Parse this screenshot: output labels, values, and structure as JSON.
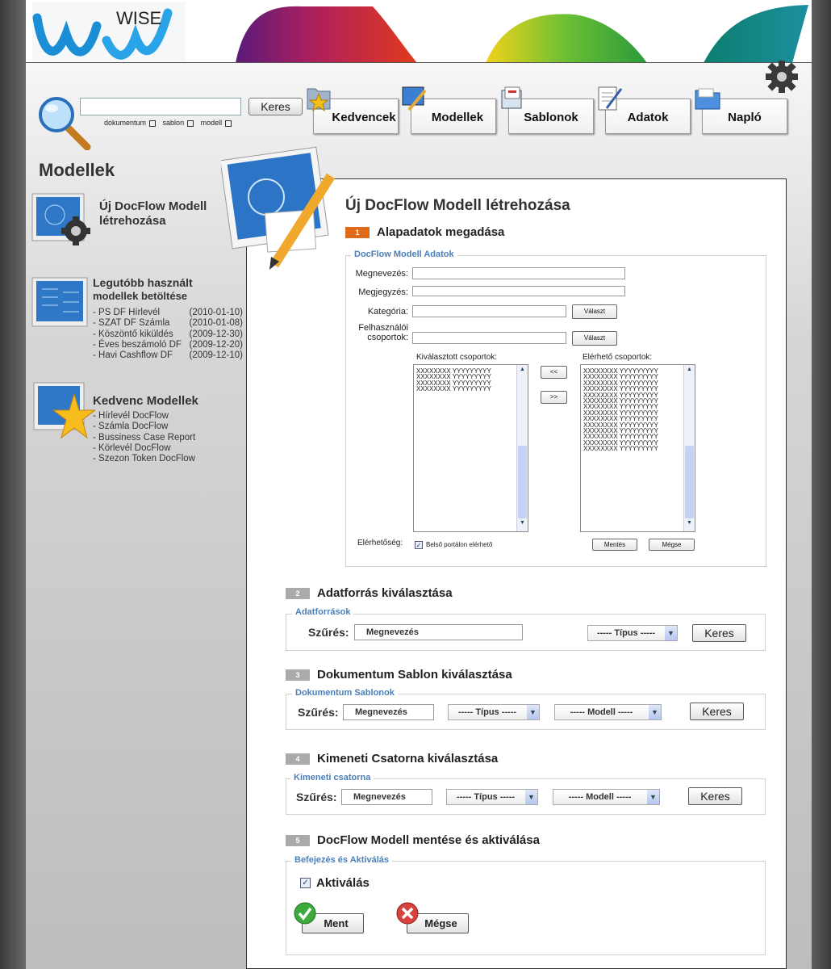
{
  "brand": {
    "logo_text": "WISE"
  },
  "search": {
    "button": "Keres",
    "scope": [
      "dokumentum",
      "sablon",
      "modell"
    ]
  },
  "nav": {
    "tabs": [
      "Kedvencek",
      "Modellek",
      "Sablonok",
      "Adatok",
      "Napló"
    ]
  },
  "sidebar": {
    "title": "Modellek",
    "new_model": "Új DocFlow Modell létrehozása",
    "recent_title_1": "Legutóbb használt",
    "recent_title_2": "modellek betöltése",
    "recent": [
      {
        "name": "- PS DF Hírlevél",
        "date": "(2010-01-10)"
      },
      {
        "name": "- SZAT DF Számla",
        "date": "(2010-01-08)"
      },
      {
        "name": "- Köszöntő kiküldés",
        "date": "(2009-12-30)"
      },
      {
        "name": "- Éves beszámoló DF",
        "date": "(2009-12-20)"
      },
      {
        "name": "- Havi Cashflow DF",
        "date": "(2009-12-10)"
      }
    ],
    "fav_title": "Kedvenc Modellek",
    "favorites": [
      "- Hírlevél DocFlow",
      "- Számla DocFlow",
      "- Bussiness Case Report",
      "- Körlevél DocFlow",
      "- Szezon Token DocFlow"
    ]
  },
  "main": {
    "title": "Új DocFlow Modell létrehozása",
    "step1": {
      "num": "1",
      "title": "Alapadatok megadása",
      "legend": "DocFlow Modell Adatok",
      "labels": {
        "name": "Megnevezés:",
        "note": "Megjegyzés:",
        "category": "Kategória:",
        "user_groups_1": "Felhasználói",
        "user_groups_2": "csoportok:"
      },
      "choose": "Választ",
      "selected_title": "Kiválasztott csoportok:",
      "available_title": "Elérhető csoportok:",
      "selected": [
        "XXXXXXXX  YYYYYYYYY",
        "XXXXXXXX  YYYYYYYYY",
        "XXXXXXXX  YYYYYYYYY",
        "XXXXXXXX  YYYYYYYYY"
      ],
      "available": [
        "XXXXXXXX  YYYYYYYYY",
        "XXXXXXXX  YYYYYYYYY",
        "XXXXXXXX  YYYYYYYYY",
        "XXXXXXXX  YYYYYYYYY",
        "XXXXXXXX  YYYYYYYYY",
        "XXXXXXXX  YYYYYYYYY",
        "XXXXXXXX  YYYYYYYYY",
        "XXXXXXXX  YYYYYYYYY",
        "XXXXXXXX  YYYYYYYYY",
        "XXXXXXXX  YYYYYYYYY",
        "XXXXXXXX  YYYYYYYYY",
        "XXXXXXXX  YYYYYYYYY",
        "XXXXXXXX  YYYYYYYYY",
        "XXXXXXXX  YYYYYYYYY"
      ],
      "move_left": "<<",
      "move_right": ">>",
      "availability_label": "Elérhetőség:",
      "availability_option": "Belső portálon elérhető",
      "save": "Mentés",
      "cancel": "Mégse"
    },
    "step2": {
      "num": "2",
      "title": "Adatforrás kiválasztása",
      "legend": "Adatforrások",
      "filter": "Szűrés:",
      "name": "Megnevezés",
      "type": "----- Típus -----",
      "search": "Keres"
    },
    "step3": {
      "num": "3",
      "title": "Dokumentum Sablon kiválasztása",
      "legend": "Dokumentum Sablonok",
      "filter": "Szűrés:",
      "name": "Megnevezés",
      "type": "----- Típus -----",
      "model": "-----  Modell  -----",
      "search": "Keres"
    },
    "step4": {
      "num": "4",
      "title": "Kimeneti Csatorna kiválasztása",
      "legend": "Kimeneti csatorna",
      "filter": "Szűrés:",
      "name": "Megnevezés",
      "type": "----- Típus -----",
      "model": "-----  Modell  -----",
      "search": "Keres"
    },
    "step5": {
      "num": "5",
      "title": "DocFlow Modell mentése és aktiválása",
      "legend": "Befejezés és Aktiválás",
      "activate": "Aktiválás",
      "ok": "Ment",
      "cancel": "Mégse"
    }
  }
}
